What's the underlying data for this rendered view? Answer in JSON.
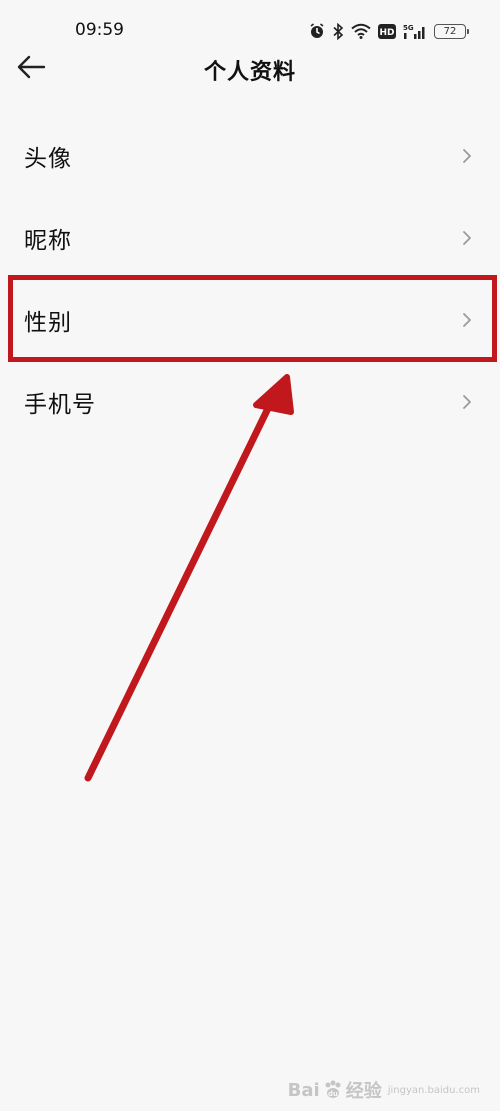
{
  "status_bar": {
    "time": "09:59",
    "battery": "72",
    "network": "5G",
    "hd": "HD"
  },
  "header": {
    "title": "个人资料",
    "back_icon": "arrow-left-icon"
  },
  "menu": {
    "items": [
      {
        "label": "头像"
      },
      {
        "label": "昵称"
      },
      {
        "label": "性别"
      },
      {
        "label": "手机号"
      }
    ],
    "chevron_icon": "chevron-right-icon"
  },
  "annotation": {
    "color": "#c0181c",
    "highlighted_item": "性别"
  },
  "watermark": {
    "brand": "Bai",
    "paw": "du",
    "suffix": "经验",
    "sub": "jingyan.baidu.com"
  },
  "colors": {
    "background": "#f7f7f7",
    "text": "#111111",
    "chevron": "#9a9a9a"
  }
}
